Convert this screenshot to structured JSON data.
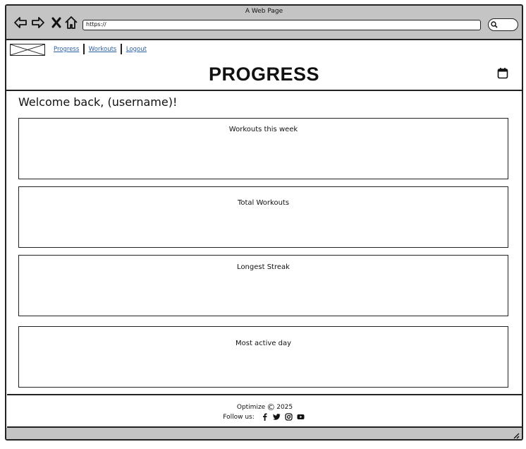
{
  "browser": {
    "title": "A Web Page",
    "url": "https://",
    "icons": [
      "back-icon",
      "forward-icon",
      "close-icon",
      "home-icon",
      "search-icon"
    ]
  },
  "nav": {
    "logo": "logo-placeholder",
    "links": [
      "Progress",
      "Workouts",
      "Logout"
    ]
  },
  "header": {
    "title": "PROGRESS",
    "icon": "calendar-icon"
  },
  "welcome": "Welcome back,  (username)!",
  "cards": [
    {
      "title": "Workouts this week"
    },
    {
      "title": "Total Workouts"
    },
    {
      "title": "Longest Streak"
    },
    {
      "title": "Most active day"
    }
  ],
  "footer": {
    "brand": "Optimize",
    "copyright_symbol": "©",
    "year": "2025",
    "follow_label": "Follow us:",
    "social_icons": [
      "facebook-icon",
      "twitter-icon",
      "instagram-icon",
      "youtube-icon"
    ]
  }
}
